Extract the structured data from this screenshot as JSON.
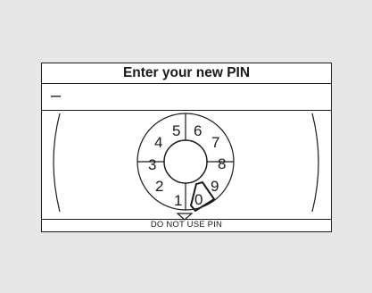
{
  "screen": {
    "title": "Enter your new PIN",
    "entry_value": "–",
    "footer_label": "DO NOT USE PIN"
  },
  "dial": {
    "digits": [
      "0",
      "1",
      "2",
      "3",
      "4",
      "5",
      "6",
      "7",
      "8",
      "9"
    ],
    "selected_digit": "0"
  }
}
